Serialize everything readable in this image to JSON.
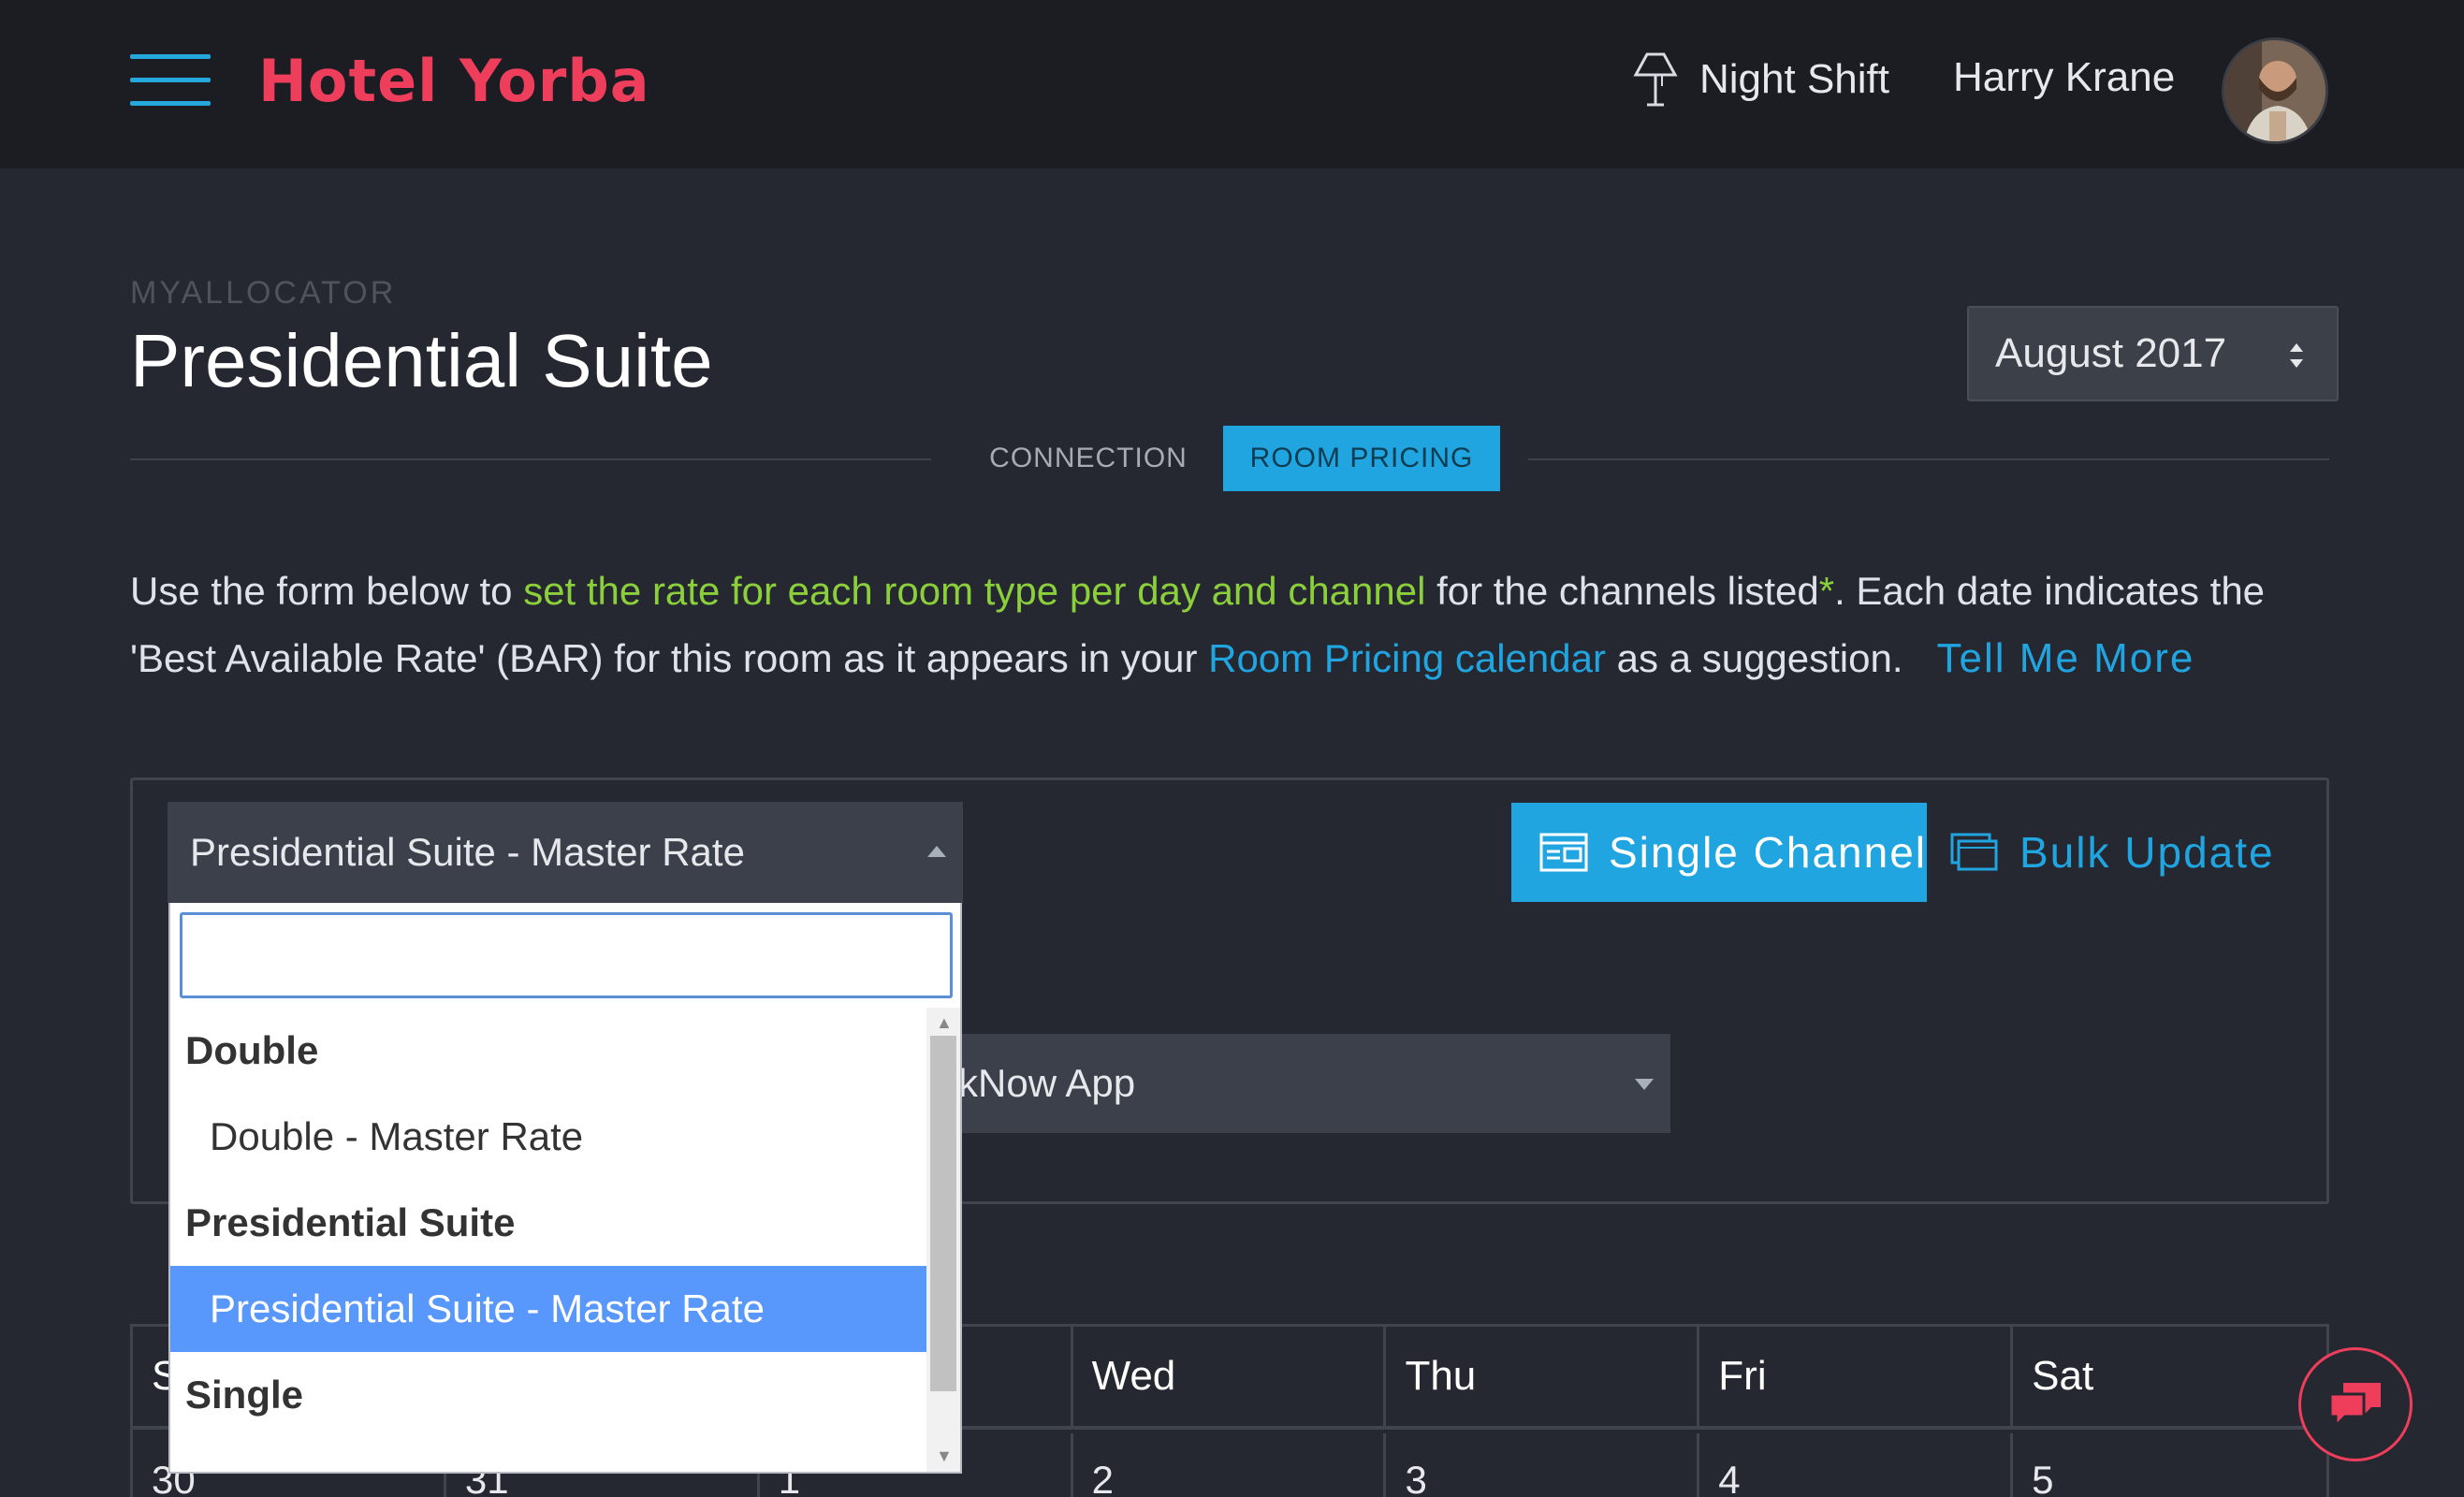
{
  "header": {
    "brand": "Hotel Yorba",
    "night_shift_label": "Night Shift",
    "user_name": "Harry Krane"
  },
  "page": {
    "overline": "MYALLOCATOR",
    "title": "Presidential Suite",
    "month": "August 2017"
  },
  "tabs": [
    {
      "label": "CONNECTION",
      "active": false
    },
    {
      "label": "ROOM PRICING",
      "active": true
    }
  ],
  "description": {
    "part1": "Use the form below to ",
    "highlight": "set the rate for each room type per day and channel",
    "part2": " for the channels listed",
    "asterisk": "*",
    "part3": ". Each date indicates the 'Best Available Rate' (BAR) for this room as it appears in your ",
    "link": "Room Pricing calendar",
    "part4": " as a suggestion.",
    "tell_more": "Tell Me More"
  },
  "rate_select": {
    "value": "Presidential Suite - Master Rate"
  },
  "mode_buttons": {
    "single": "Single Channel",
    "bulk": "Bulk Update"
  },
  "channel_select": {
    "visible_value": "kNow App"
  },
  "dropdown": {
    "search_value": "",
    "groups": [
      {
        "label": "Double",
        "options": [
          "Double - Master Rate"
        ]
      },
      {
        "label": "Presidential Suite",
        "options": [
          "Presidential Suite - Master Rate"
        ]
      },
      {
        "label": "Single",
        "options": []
      }
    ],
    "selected": "Presidential Suite - Master Rate"
  },
  "calendar": {
    "headers": [
      "S",
      "",
      "",
      "Wed",
      "Thu",
      "Fri",
      "Sat"
    ],
    "row1": [
      "30",
      "31",
      "1",
      "2",
      "3",
      "4",
      "5"
    ]
  },
  "colors": {
    "accent": "#21a5e1",
    "brand": "#ef3e5c",
    "highlight_green": "#8bcf3b",
    "background": "#252831",
    "topbar": "#1b1d23"
  }
}
